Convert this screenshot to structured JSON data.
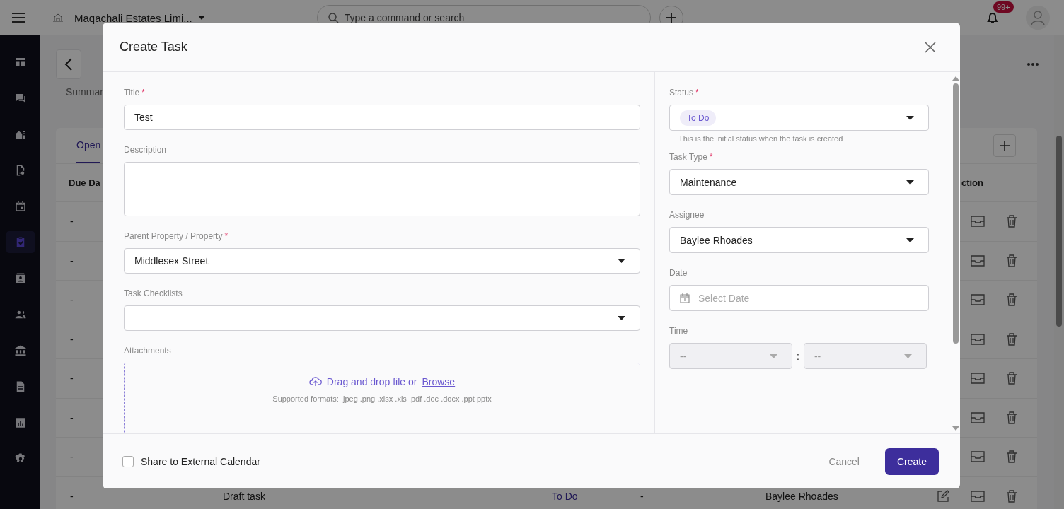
{
  "app_bar": {
    "company": "Maqachali Estates Limi...",
    "search": {
      "placeholder": "Type a command or search"
    },
    "notifications_badge": "99+"
  },
  "sidebar": {
    "items": [
      {
        "kind": "layout",
        "selected": false
      },
      {
        "kind": "chat",
        "selected": false
      },
      {
        "kind": "building",
        "selected": false
      },
      {
        "kind": "key-document",
        "selected": false
      },
      {
        "kind": "calendar",
        "selected": false
      },
      {
        "kind": "tasks",
        "selected": true
      },
      {
        "kind": "contact",
        "selected": false
      },
      {
        "kind": "people",
        "selected": false
      },
      {
        "kind": "bank",
        "selected": false
      },
      {
        "kind": "document",
        "selected": false
      },
      {
        "kind": "chart",
        "selected": false
      },
      {
        "kind": "gear",
        "selected": false
      }
    ]
  },
  "page": {
    "tabs": [
      {
        "label": "Summar",
        "selected": false
      }
    ],
    "list_tabs": [
      {
        "label": "Open",
        "selected": true
      }
    ],
    "table": {
      "columns": [
        {
          "label": "Due Da"
        },
        {
          "label": "ction"
        }
      ],
      "rows": [
        {
          "due": "-"
        },
        {
          "due": "-"
        },
        {
          "due": "-"
        },
        {
          "due": "-"
        },
        {
          "due": "-"
        },
        {
          "due": "-"
        },
        {
          "due": "-"
        },
        {
          "due": "-",
          "title": "Draft task",
          "status": "To Do",
          "column_4": "-",
          "assignee": "Baylee Rhoades"
        }
      ]
    }
  },
  "modal": {
    "title": "Create Task",
    "left_fields": [
      {
        "kind": "text",
        "label": "Title",
        "required_mark": "*",
        "value": "Test"
      },
      {
        "kind": "textarea",
        "label": "Description"
      },
      {
        "kind": "select",
        "label": "Parent Property / Property",
        "required_mark": "*",
        "value": "Middlesex Street"
      },
      {
        "kind": "select",
        "label": "Task Checklists"
      },
      {
        "kind": "dropzone",
        "label": "Attachments",
        "prompt": "Drag and drop file or",
        "link": "Browse",
        "formats": "Supported formats: .jpeg .png .xlsx .xls .pdf .doc .docx .ppt pptx"
      }
    ],
    "right_fields": [
      {
        "kind": "chip-select",
        "label": "Status",
        "required_mark": "*",
        "value": "To Do",
        "hint": "This is the initial status when the task is created"
      },
      {
        "kind": "select",
        "label": "Task Type",
        "required_mark": "*",
        "value": "Maintenance"
      },
      {
        "kind": "select",
        "label": "Assignee",
        "value": "Baylee Rhoades"
      },
      {
        "kind": "date",
        "label": "Date",
        "placeholder": "Select Date"
      },
      {
        "kind": "time",
        "label": "Time",
        "hour": "--",
        "separator": ":",
        "minute": "--",
        "disabled": true
      }
    ],
    "footer": {
      "share": {
        "label": "Share to External Calendar",
        "checked": false
      },
      "cancel": "Cancel",
      "create": "Create"
    }
  }
}
